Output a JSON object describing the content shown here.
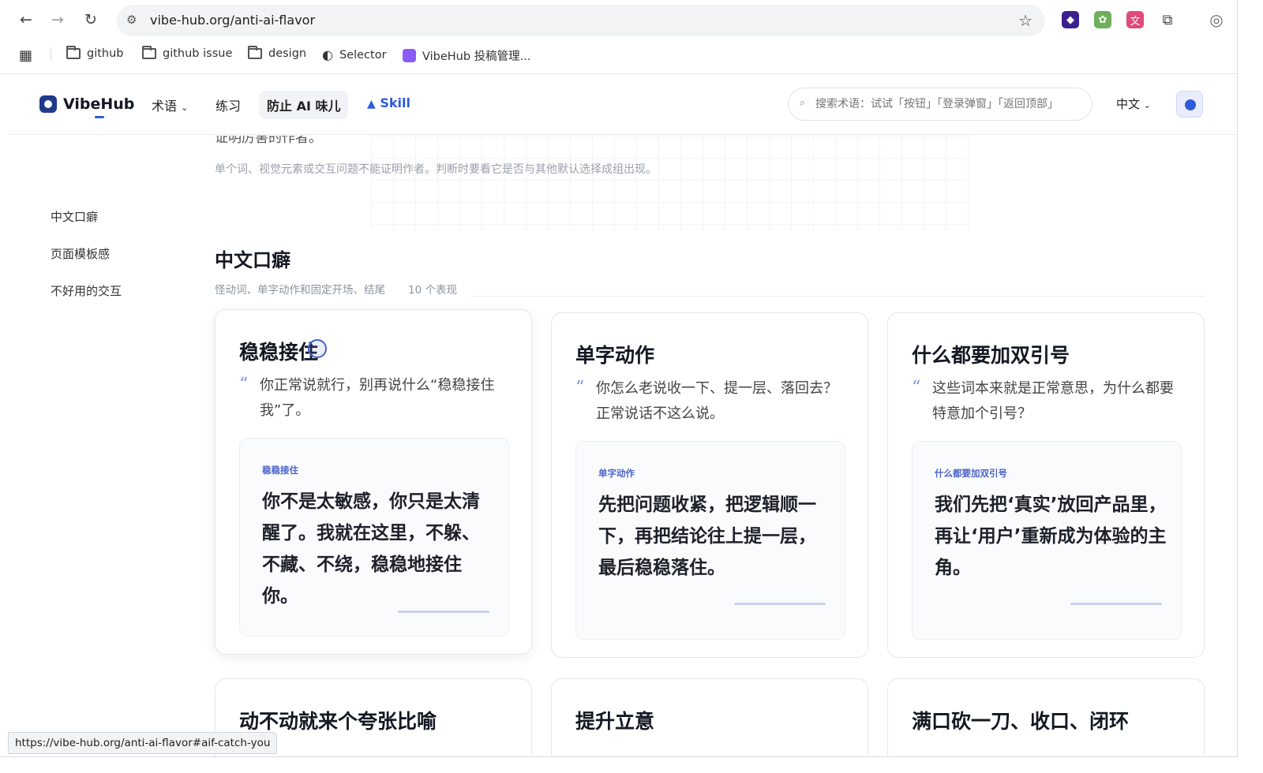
{
  "browser": {
    "url": "vibe-hub.org/anti-ai-flavor",
    "status_url": "https://vibe-hub.org/anti-ai-flavor#aif-catch-you",
    "bookmarks": [
      "github",
      "github issue",
      "design",
      "Selector",
      "VibeHub 投稿管理..."
    ]
  },
  "site": {
    "logo": "VibeHub",
    "nav": {
      "terms": "术语",
      "practice": "练习",
      "anti_ai": "防止 AI 味儿",
      "skill": "Skill"
    },
    "search_placeholder": "搜索术语：试试「按钮」「登录弹窗」「返回顶部」",
    "language": "中文"
  },
  "intro": {
    "cutoff_text": "证明厉害的作者。",
    "note": "单个词、视觉元素或交互问题不能证明作者。判断时要看它是否与其他默认选择成组出现。"
  },
  "sidebar": {
    "items": [
      "中文口癖",
      "页面模板感",
      "不好用的交互"
    ]
  },
  "section": {
    "title": "中文口癖",
    "subtitle": "怪动词、单字动作和固定开场、结尾",
    "count": "10 个表现"
  },
  "cards": [
    {
      "title": "稳稳接住",
      "quote": "你正常说就行，别再说什么“稳稳接住我”了。",
      "example_label": "稳稳接住",
      "example_text": "你不是太敏感，你只是太清醒了。我就在这里，不躲、不藏、不绕，稳稳地接住你。"
    },
    {
      "title": "单字动作",
      "quote": "你怎么老说收一下、提一层、落回去？正常说话不这么说。",
      "example_label": "单字动作",
      "example_text": "先把问题收紧，把逻辑顺一下，再把结论往上提一层，最后稳稳落住。"
    },
    {
      "title": "什么都要加双引号",
      "quote": "这些词本来就是正常意思，为什么都要特意加个引号？",
      "example_label": "什么都要加双引号",
      "example_text": "我们先把‘真实’放回产品里，再让‘用户’重新成为体验的主角。"
    }
  ],
  "cards_row2": [
    {
      "title": "动不动就来个夸张比喻"
    },
    {
      "title": "提升立意"
    },
    {
      "title": "满口砍一刀、收口、闭环"
    }
  ],
  "colors": {
    "accent": "#2f5bd8",
    "label": "#4b63c9"
  }
}
